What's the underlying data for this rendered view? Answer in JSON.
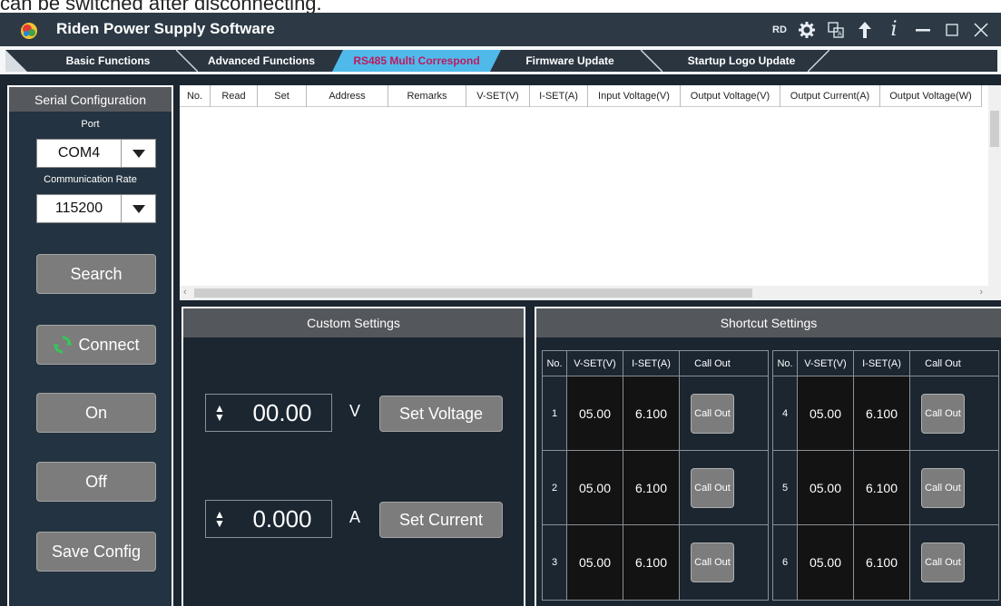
{
  "caption": "can be switched after disconnecting.",
  "window": {
    "title": "Riden Power Supply Software",
    "rd_label": "RD",
    "icons": [
      "gear-icon",
      "language-icon",
      "upload-arrow-icon",
      "info-icon",
      "minimize-icon",
      "maximize-icon",
      "close-icon"
    ]
  },
  "tabs": [
    {
      "label": "Basic Functions",
      "active": false
    },
    {
      "label": "Advanced Functions",
      "active": false
    },
    {
      "label": "RS485 Multi Correspond",
      "active": true
    },
    {
      "label": "Firmware Update",
      "active": false
    },
    {
      "label": "Startup Logo Update",
      "active": false
    }
  ],
  "serial": {
    "header": "Serial Configuration",
    "port_label": "Port",
    "port_value": "COM4",
    "rate_label": "Communication Rate",
    "rate_value": "115200",
    "buttons": {
      "search": "Search",
      "connect": "Connect",
      "on": "On",
      "off": "Off",
      "save": "Save Config"
    }
  },
  "table": {
    "columns": [
      "No.",
      "Read",
      "Set",
      "Address",
      "Remarks",
      "V-SET(V)",
      "I-SET(A)",
      "Input Voltage(V)",
      "Output Voltage(V)",
      "Output Current(A)",
      "Output Voltage(W)"
    ],
    "rows": []
  },
  "custom": {
    "header": "Custom Settings",
    "voltage_value": "00.00",
    "voltage_unit": "V",
    "set_voltage": "Set Voltage",
    "current_value": "0.000",
    "current_unit": "A",
    "set_current": "Set Current"
  },
  "shortcut": {
    "header": "Shortcut Settings",
    "columns": [
      "No.",
      "V-SET(V)",
      "I-SET(A)",
      "Call Out"
    ],
    "call_out_label": "Call Out",
    "left": [
      {
        "no": "1",
        "v": "05.00",
        "i": "6.100"
      },
      {
        "no": "2",
        "v": "05.00",
        "i": "6.100"
      },
      {
        "no": "3",
        "v": "05.00",
        "i": "6.100"
      }
    ],
    "right": [
      {
        "no": "4",
        "v": "05.00",
        "i": "6.100"
      },
      {
        "no": "5",
        "v": "05.00",
        "i": "6.100"
      },
      {
        "no": "6",
        "v": "05.00",
        "i": "6.100"
      }
    ]
  },
  "colors": {
    "background": "#1b2631",
    "titlebar": "#2d3a46",
    "active_tab": "#4fb9ea",
    "active_tab_text": "#c1185f",
    "button": "#7c7c7c",
    "connect_icon": "#34c759"
  }
}
